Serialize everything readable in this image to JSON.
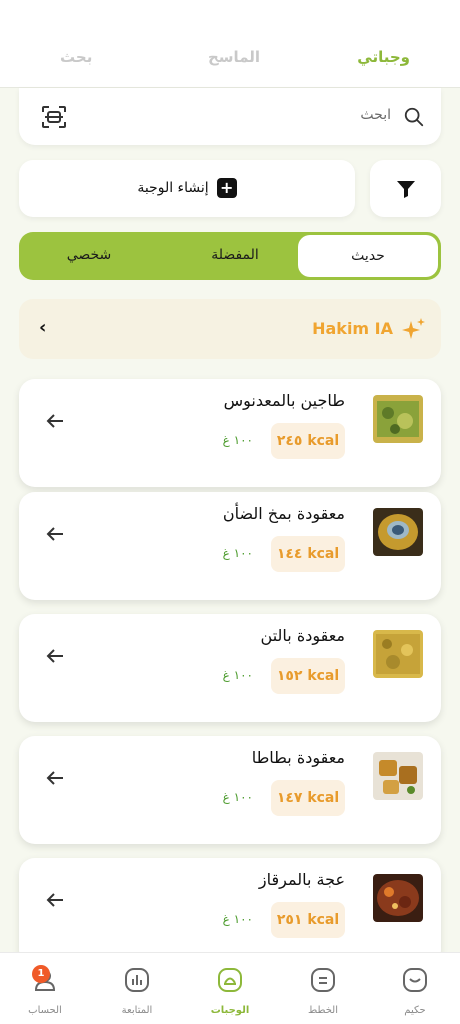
{
  "top_tabs": {
    "meals": "وجباتي",
    "scan": "الماسح",
    "search": "بحث"
  },
  "search": {
    "placeholder": "ابحث"
  },
  "create_button": {
    "label": "إنشاء الوجبة"
  },
  "segments": {
    "recent": "حديث",
    "favorites": "المفضلة",
    "personal": "شخصي"
  },
  "hakim": {
    "title": "Hakim IA"
  },
  "meals": [
    {
      "name": "طاجين بالمعدنوس",
      "kcal": "٢٤٥ kcal",
      "grams": "١٠٠ غ"
    },
    {
      "name": "معقودة بمخ الضأن",
      "kcal": "١٤٤ kcal",
      "grams": "١٠٠ غ"
    },
    {
      "name": "معقودة بالتن",
      "kcal": "١٥٢ kcal",
      "grams": "١٠٠ غ"
    },
    {
      "name": "معقودة بطاطا",
      "kcal": "١٤٧ kcal",
      "grams": "١٠٠ غ"
    },
    {
      "name": "عجة بالمرقاز",
      "kcal": "٢٥١ kcal",
      "grams": "١٠٠ غ"
    }
  ],
  "bottom_nav": {
    "hakim": "حكيم",
    "plans": "الخطط",
    "meals": "الوجبات",
    "tracking": "المتابعة",
    "account": "الحساب",
    "account_badge": "1"
  },
  "colors": {
    "accent": "#8db83a",
    "segment_bg": "#9cc33f",
    "kcal": "#e89b2c",
    "grams": "#4d9c2e",
    "badge": "#f05a28"
  }
}
